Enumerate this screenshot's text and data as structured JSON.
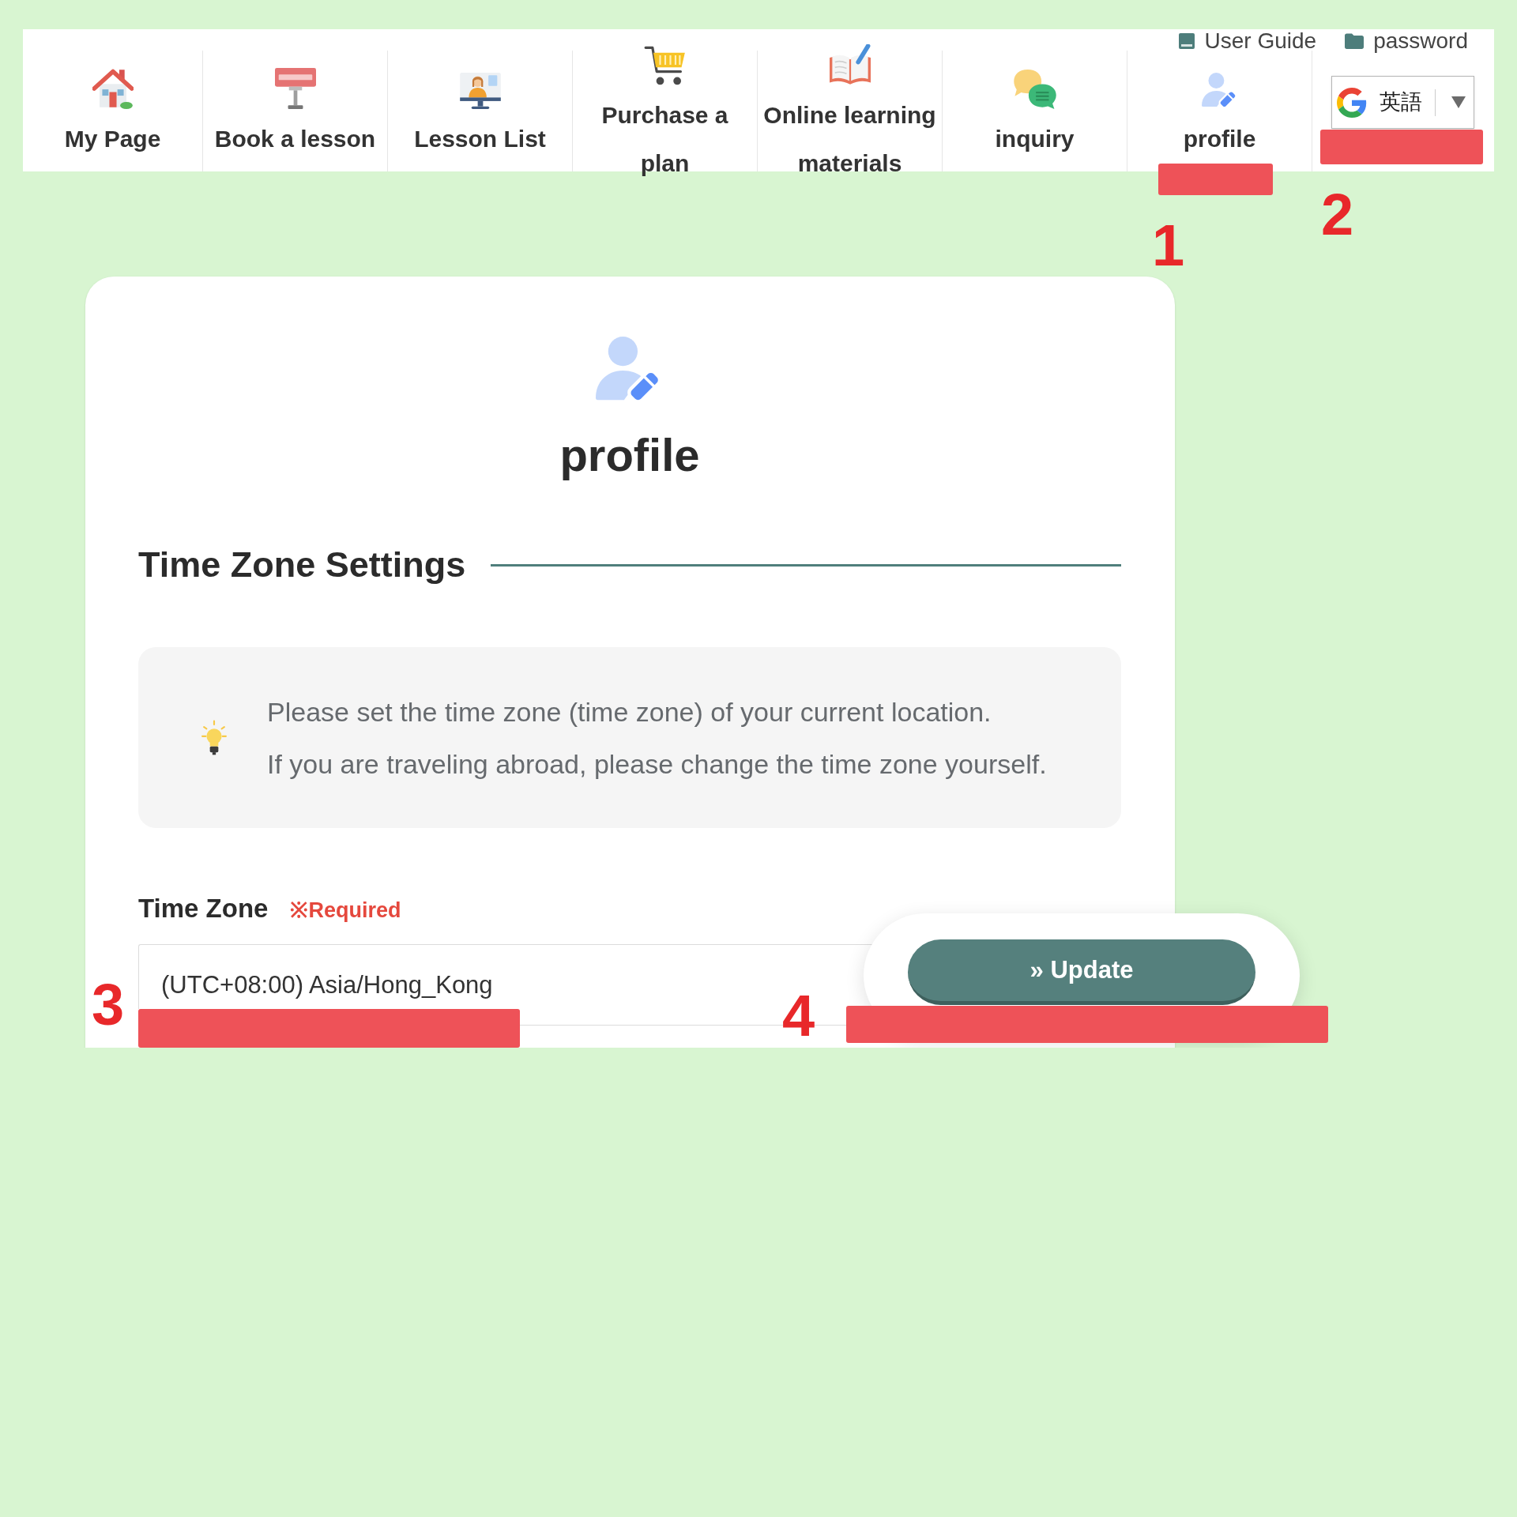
{
  "top_links": [
    {
      "label": "User Guide"
    },
    {
      "label": "password"
    }
  ],
  "nav": {
    "items": [
      {
        "label": "My Page"
      },
      {
        "label": "Book a lesson"
      },
      {
        "label": "Lesson List"
      },
      {
        "label": "Purchase a plan"
      },
      {
        "label": "Online learning materials"
      },
      {
        "label": "inquiry"
      },
      {
        "label": "profile"
      }
    ],
    "language": {
      "value": "英語"
    }
  },
  "page": {
    "title": "profile"
  },
  "section": {
    "title": "Time Zone Settings",
    "notice": [
      "Please set the time zone (time zone) of your current location.",
      "If you are traveling abroad, please change the time zone yourself."
    ],
    "field": {
      "label": "Time Zone",
      "required": "※Required",
      "value": "(UTC+08:00) Asia/Hong_Kong"
    },
    "button": "» Update"
  },
  "annotations": [
    {
      "number": "1"
    },
    {
      "number": "2"
    },
    {
      "number": "3"
    },
    {
      "number": "4"
    }
  ]
}
